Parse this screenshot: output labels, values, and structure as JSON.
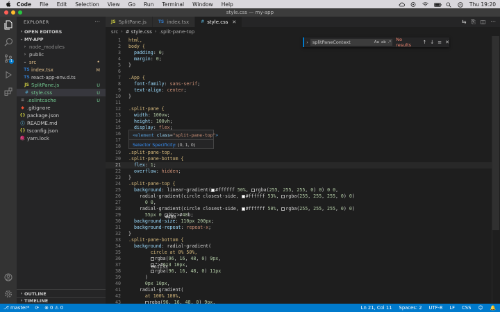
{
  "menubar": {
    "app_name": "Code",
    "items": [
      "File",
      "Edit",
      "Selection",
      "View",
      "Go",
      "Run",
      "Terminal",
      "Window",
      "Help"
    ],
    "clock": "Thu 19:20"
  },
  "window": {
    "title": "style.css — my-app"
  },
  "colors": {
    "accent": "#007acc",
    "status_bar": "#007acc",
    "untracked": "#73c991",
    "modified": "#e2c08d"
  },
  "activity_bar": {
    "icons": [
      "files-icon",
      "search-icon",
      "source-control-icon",
      "run-debug-icon",
      "extensions-icon",
      "account-icon",
      "settings-gear-icon"
    ],
    "source_control_badge": "1"
  },
  "sidebar": {
    "title": "EXPLORER",
    "open_editors": "OPEN EDITORS",
    "project": "MY-APP",
    "tree": [
      {
        "label": "node_modules",
        "type": "folder",
        "status": ""
      },
      {
        "label": "public",
        "type": "folder",
        "status": ""
      },
      {
        "label": "src",
        "type": "folder-open",
        "status": ""
      },
      {
        "label": "index.tsx",
        "type": "tsx",
        "status": "M"
      },
      {
        "label": "react-app-env.d.ts",
        "type": "ts",
        "status": ""
      },
      {
        "label": "SplitPane.js",
        "type": "js",
        "status": "U"
      },
      {
        "label": "style.css",
        "type": "css",
        "status": "U"
      },
      {
        "label": ".eslintcache",
        "type": "file",
        "status": "U"
      },
      {
        "label": ".gitignore",
        "type": "git",
        "status": ""
      },
      {
        "label": "package.json",
        "type": "json",
        "status": ""
      },
      {
        "label": "README.md",
        "type": "md",
        "status": ""
      },
      {
        "label": "tsconfig.json",
        "type": "json",
        "status": ""
      },
      {
        "label": "yarn.lock",
        "type": "yarn",
        "status": ""
      }
    ],
    "outline": "OUTLINE",
    "timeline": "TIMELINE"
  },
  "tabs": [
    {
      "label": "SplitPane.js",
      "icon": "JS",
      "active": false
    },
    {
      "label": "index.tsx",
      "icon": "TS",
      "active": false
    },
    {
      "label": "style.css",
      "icon": "#",
      "active": true
    }
  ],
  "breadcrumb": [
    "src",
    "# style.css",
    ".split-pane-top"
  ],
  "find_widget": {
    "query": "splitPaneContext",
    "options": [
      "Aa",
      "ab",
      ".*"
    ],
    "result": "No results"
  },
  "hover": {
    "element": "<element class=\"split-pane-top\">",
    "specificity_label": "Selector Specificity:",
    "specificity_value": "(0, 1, 0)"
  },
  "code_lines": [
    {
      "n": "1",
      "t": "html,"
    },
    {
      "n": "2",
      "t": "body {"
    },
    {
      "n": "3",
      "t": "  padding: 0;"
    },
    {
      "n": "4",
      "t": "  margin: 0;"
    },
    {
      "n": "5",
      "t": "}"
    },
    {
      "n": "6",
      "t": ""
    },
    {
      "n": "7",
      "t": ".App {"
    },
    {
      "n": "8",
      "t": "  font-family: sans-serif;"
    },
    {
      "n": "9",
      "t": "  text-align: center;"
    },
    {
      "n": "10",
      "t": "}"
    },
    {
      "n": "11",
      "t": ""
    },
    {
      "n": "12",
      "t": ".split-pane {"
    },
    {
      "n": "13",
      "t": "  width: 100vw;"
    },
    {
      "n": "14",
      "t": "  height: 100vh;"
    },
    {
      "n": "15",
      "t": "  display: flex;"
    },
    {
      "n": "16",
      "t": ""
    },
    {
      "n": "17",
      "t": ""
    },
    {
      "n": "18",
      "t": ""
    },
    {
      "n": "19",
      "t": ".split-pane-top,"
    },
    {
      "n": "20",
      "t": ".split-pane-bottom {"
    },
    {
      "n": "21",
      "t": "  flex: 1;"
    },
    {
      "n": "22",
      "t": "  overflow: hidden;"
    },
    {
      "n": "23",
      "t": "}"
    },
    {
      "n": "24",
      "t": ".split-pane-top {"
    },
    {
      "n": "25",
      "t": "  background: linear-gradient(▢#ffffff 50%, ▢rgba(255, 255, 255, 0) 0) 0 0,"
    },
    {
      "n": "26",
      "t": "    radial-gradient(circle closest-side, ▢#ffffff 53%, ▢rgba(255, 255, 255, 0) 0)"
    },
    {
      "n": "27",
      "t": "      0 0,"
    },
    {
      "n": "28",
      "t": "    radial-gradient(circle closest-side, ▢#ffffff 50%, ▢rgba(255, 255, 255, 0) 0)"
    },
    {
      "n": "29",
      "t": "      55px 0 ▢#48b;"
    },
    {
      "n": "30",
      "t": "  background-size: 110px 200px;"
    },
    {
      "n": "31",
      "t": "  background-repeat: repeat-x;"
    },
    {
      "n": "32",
      "t": "}"
    },
    {
      "n": "33",
      "t": ".split-pane-bottom {"
    },
    {
      "n": "34",
      "t": "  background: radial-gradient("
    },
    {
      "n": "35",
      "t": "        circle at 0% 50%,"
    },
    {
      "n": "36",
      "t": "        ▢rgba(96, 16, 48, 0) 9px,"
    },
    {
      "n": "37",
      "t": "        ▢#613 10px,"
    },
    {
      "n": "38",
      "t": "        ▢rgba(96, 16, 48, 0) 11px"
    },
    {
      "n": "39",
      "t": "      )"
    },
    {
      "n": "40",
      "t": "      0px 10px,"
    },
    {
      "n": "41",
      "t": "    radial-gradient("
    },
    {
      "n": "42",
      "t": "      at 100% 100%,"
    },
    {
      "n": "43",
      "t": "      ▢rgba(96, 16, 48, 0) 9px,"
    }
  ],
  "current_line": "21",
  "statusbar": {
    "branch": "master*",
    "errors": "0",
    "warnings": "0",
    "position": "Ln 21, Col 11",
    "indent": "Spaces: 2",
    "encoding": "UTF-8",
    "eol": "LF",
    "language": "CSS"
  }
}
